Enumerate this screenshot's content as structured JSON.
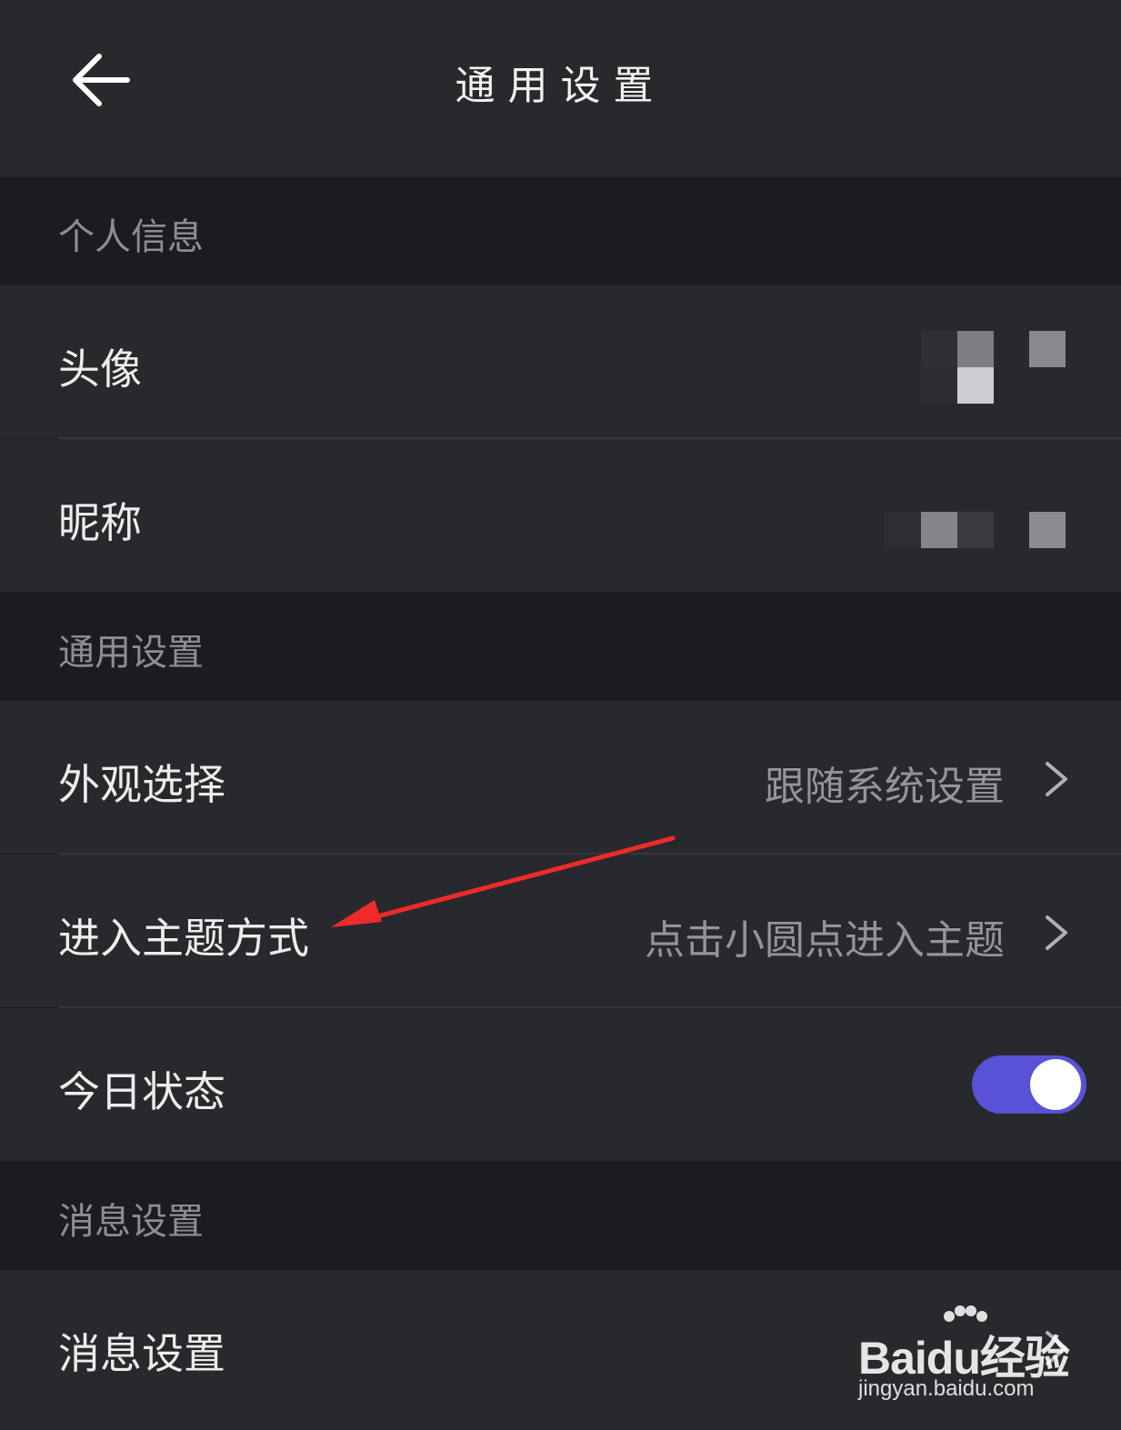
{
  "header": {
    "title": "通用设置",
    "back_icon": "arrow-left-icon"
  },
  "sections": {
    "personal": {
      "title": "个人信息"
    },
    "general": {
      "title": "通用设置"
    },
    "message": {
      "title": "消息设置"
    }
  },
  "rows": {
    "avatar": {
      "label": "头像"
    },
    "nickname": {
      "label": "昵称"
    },
    "appearance": {
      "label": "外观选择",
      "value": "跟随系统设置"
    },
    "theme_entry": {
      "label": "进入主题方式",
      "value": "点击小圆点进入主题"
    },
    "today_status": {
      "label": "今日状态",
      "toggle_on": true
    },
    "message_settings": {
      "label": "消息设置"
    }
  },
  "colors": {
    "background": "#1b1c1f",
    "row_background": "#28292d",
    "toggle_accent": "#5951d6",
    "annotation_arrow": "#f02a2a"
  },
  "watermark": {
    "brand": "Baidu经验",
    "url": "jingyan.baidu.com"
  }
}
